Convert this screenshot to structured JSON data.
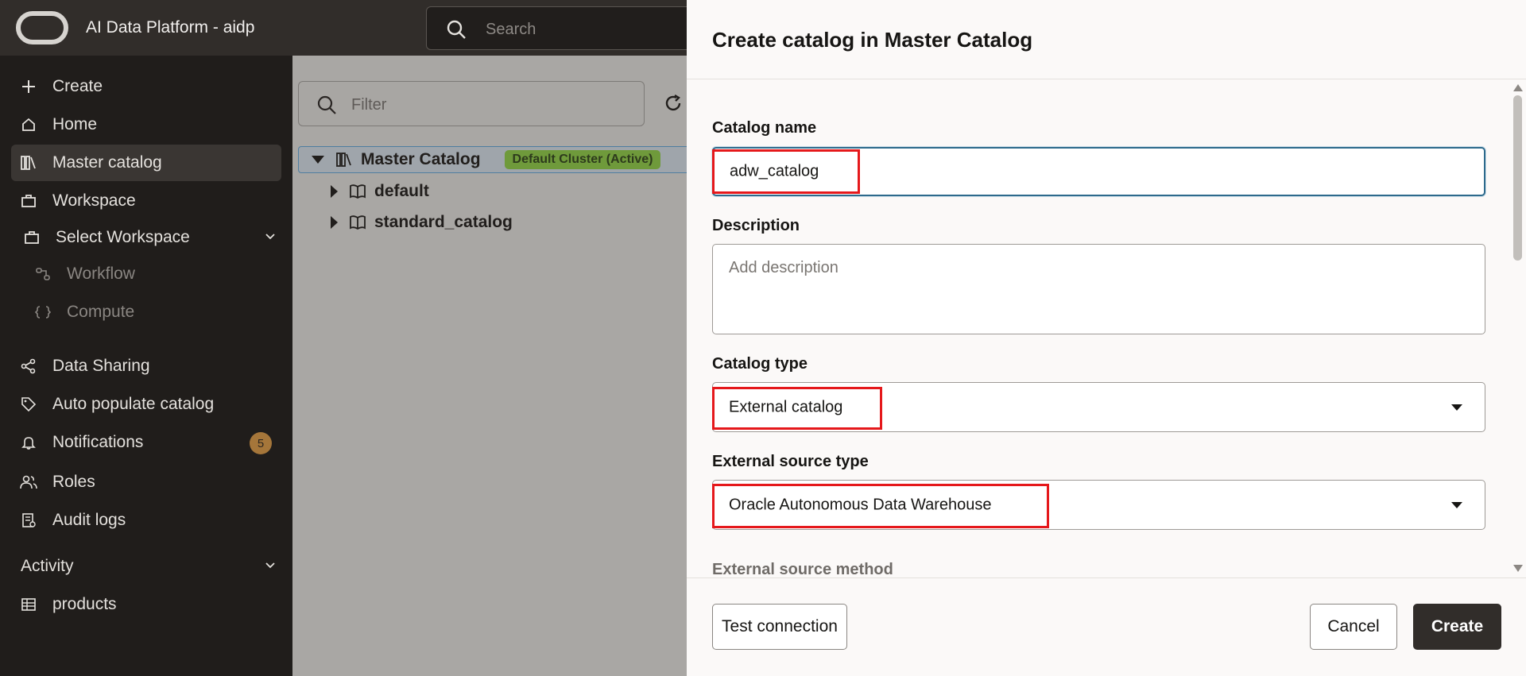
{
  "header": {
    "app_title": "AI Data Platform - aidp",
    "search_placeholder": "Search"
  },
  "sidebar": {
    "create": "Create",
    "home": "Home",
    "master_catalog": "Master catalog",
    "workspace": "Workspace",
    "select_workspace": "Select Workspace",
    "workflow": "Workflow",
    "compute": "Compute",
    "data_sharing": "Data Sharing",
    "auto_populate": "Auto populate catalog",
    "notifications": "Notifications",
    "notifications_count": "5",
    "roles": "Roles",
    "audit_logs": "Audit logs",
    "activity": "Activity",
    "products": "products"
  },
  "main": {
    "filter_placeholder": "Filter",
    "tree": {
      "root": "Master Catalog",
      "root_badge": "Default Cluster (Active)",
      "children": [
        "default",
        "standard_catalog"
      ]
    }
  },
  "drawer": {
    "title": "Create catalog in Master Catalog",
    "catalog_name_label": "Catalog name",
    "catalog_name_value": "adw_catalog",
    "description_label": "Description",
    "description_placeholder": "Add description",
    "catalog_type_label": "Catalog type",
    "catalog_type_value": "External catalog",
    "external_source_type_label": "External source type",
    "external_source_type_value": "Oracle Autonomous Data Warehouse",
    "external_source_method_label": "External source method",
    "test_connection": "Test connection",
    "cancel": "Cancel",
    "create": "Create"
  },
  "colors": {
    "header_bg": "#312d2a",
    "sidebar_bg": "#201d1b",
    "highlight_red": "#e5181b",
    "focus_blue": "#2d6a8c",
    "badge_green": "#6f9a3b",
    "notification_badge": "#a5763a"
  }
}
